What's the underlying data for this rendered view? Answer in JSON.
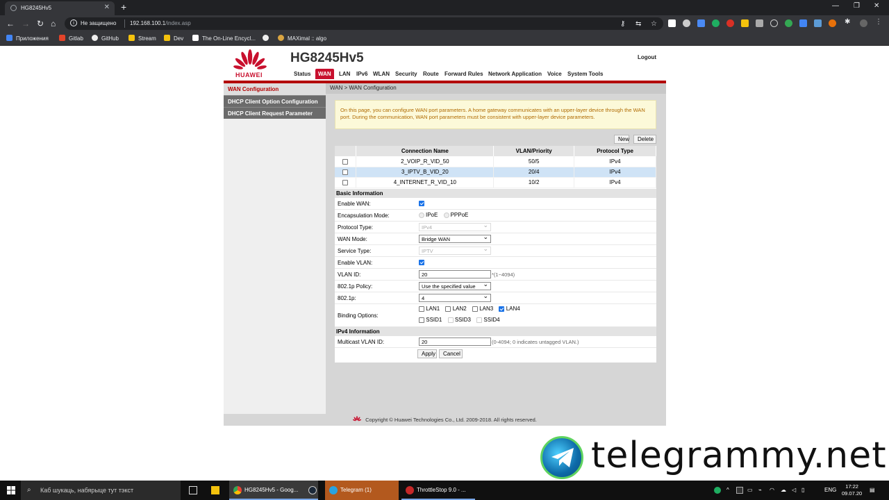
{
  "browser": {
    "tab_title": "HG8245Hv5",
    "address_secure_label": "Не защищено",
    "address_host": "192.168.100.1",
    "address_path": "/index.asp",
    "bookmarks": [
      "Приложения",
      "Gitlab",
      "GitHub",
      "Stream",
      "Dev",
      "The On-Line Encycl...",
      "MAXimal :: algo"
    ]
  },
  "router": {
    "brand": "HUAWEI",
    "model": "HG8245Hv5",
    "logout": "Logout",
    "menu": [
      "Status",
      "WAN",
      "LAN",
      "IPv6",
      "WLAN",
      "Security",
      "Route",
      "Forward Rules",
      "Network Application",
      "Voice",
      "System Tools"
    ],
    "active_menu": "WAN",
    "sidebar": [
      "WAN Configuration",
      "DHCP Client Option Configuration",
      "DHCP Client Request Parameter"
    ],
    "breadcrumb": "WAN > WAN Configuration",
    "notice": "On this page, you can configure WAN port parameters. A home gateway communicates with an upper-layer device through the WAN port. During the communication, WAN port parameters must be consistent with upper-layer device parameters.",
    "buttons": {
      "new": "New",
      "delete": "Delete",
      "apply": "Apply",
      "cancel": "Cancel"
    },
    "table": {
      "headers": [
        "Connection Name",
        "VLAN/Priority",
        "Protocol Type"
      ],
      "rows": [
        {
          "name": "2_VOIP_R_VID_50",
          "vlan": "50/5",
          "proto": "IPv4"
        },
        {
          "name": "3_IPTV_B_VID_20",
          "vlan": "20/4",
          "proto": "IPv4",
          "selected": true
        },
        {
          "name": "4_INTERNET_R_VID_10",
          "vlan": "10/2",
          "proto": "IPv4"
        }
      ]
    },
    "basic": {
      "title": "Basic Information",
      "enable_wan_label": "Enable WAN:",
      "encap_label": "Encapsulation Mode:",
      "encap_opt1": "IPoE",
      "encap_opt2": "PPPoE",
      "protocol_label": "Protocol Type:",
      "protocol_value": "IPv4",
      "wan_mode_label": "WAN Mode:",
      "wan_mode_value": "Bridge WAN",
      "service_label": "Service Type:",
      "service_value": "IPTV",
      "enable_vlan_label": "Enable VLAN:",
      "vlan_id_label": "VLAN ID:",
      "vlan_id_value": "20",
      "vlan_id_hint": "*(1~4094)",
      "policy_label": "802.1p Policy:",
      "policy_value": "Use the specified value",
      "p_label": "802.1p:",
      "p_value": "4",
      "binding_label": "Binding Options:",
      "lan": [
        "LAN1",
        "LAN2",
        "LAN3",
        "LAN4"
      ],
      "ssid": [
        "SSID1",
        "SSID3",
        "SSID4"
      ]
    },
    "ipv4": {
      "title": "IPv4 Information",
      "mcast_label": "Multicast VLAN ID:",
      "mcast_value": "20",
      "mcast_hint": "(0-4094; 0 indicates untagged VLAN.)"
    },
    "footer": "Copyright © Huawei Technologies Co., Ltd. 2009-2018. All rights reserved."
  },
  "watermark": "telegrammy.net",
  "taskbar": {
    "search_placeholder": "Каб шукаць, набярыце тут тэкст",
    "apps": [
      "HG8245Hv5 - Goog...",
      "Telegram (1)",
      "ThrottleStop 9.0 - ..."
    ],
    "lang": "ENG",
    "time": "17:22",
    "date": "09.07.20"
  },
  "colors": {
    "accent": "#c8102e",
    "redbar": "#b30000",
    "selected_row": "#cfe3f6"
  }
}
